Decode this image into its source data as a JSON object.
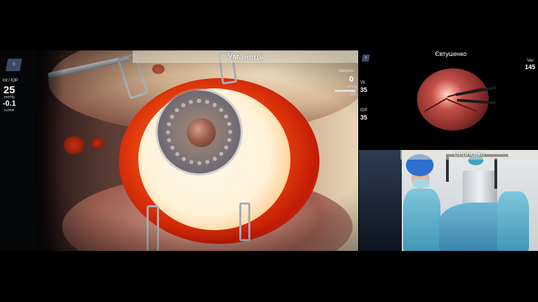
{
  "main_feed": {
    "surgeon_name": "Уманець",
    "overlay": {
      "logo_text": "0",
      "infusion_label": "Inf / IOP",
      "infusion_value": "25",
      "infusion_unit": "mmHg",
      "flow_value": "-0.1",
      "flow_unit": "cc/min",
      "vacuum_label": "Vacuum",
      "vacuum_value": "0",
      "vacuum_unit": "mmHg",
      "vacuum_max": "200"
    }
  },
  "fundus_feed": {
    "surgeon_name": "Євтушенко",
    "overlay": {
      "logo_text": "0",
      "top_right_value": "145",
      "top_right_label": "Vac",
      "left_value_1": "35",
      "left_label_1": "Vit",
      "left_value_2": "35",
      "left_label_2": "IOP"
    }
  },
  "or_feed": {
    "surgeon_name": "Сергієнко"
  },
  "colors": {
    "background": "#000000",
    "name_bar": "#e6e1d2",
    "blood": "#c21b05",
    "surgical_cap": "#2f6fd0"
  }
}
